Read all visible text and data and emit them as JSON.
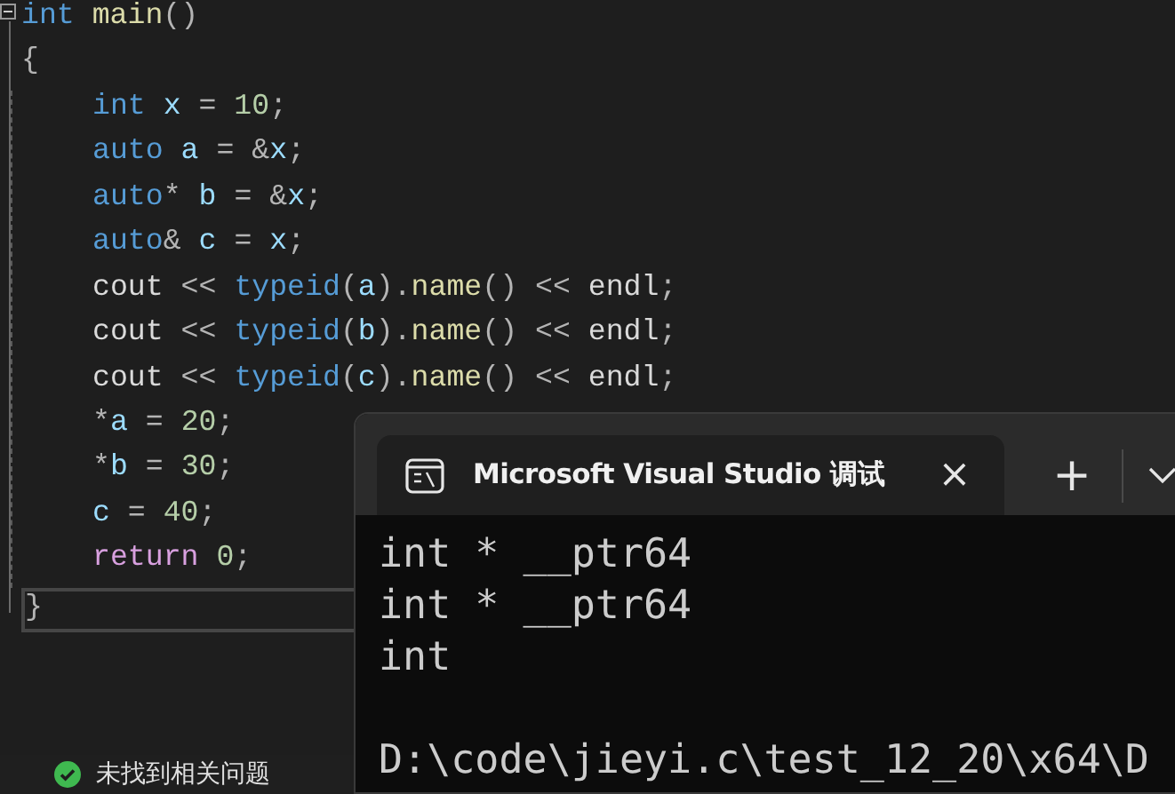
{
  "editor": {
    "function": {
      "expanded": true,
      "header": [
        {
          "text": "int",
          "kind": "keyword"
        },
        {
          "text": " main",
          "kind": "function"
        },
        {
          "text": "()",
          "kind": "punct"
        }
      ],
      "open_brace": "{",
      "body": [
        [
          {
            "text": "int",
            "kind": "keyword"
          },
          {
            "text": " x",
            "kind": "variable"
          },
          {
            "text": " = ",
            "kind": "punct"
          },
          {
            "text": "10",
            "kind": "number"
          },
          {
            "text": ";",
            "kind": "punct"
          }
        ],
        [
          {
            "text": "auto",
            "kind": "keyword"
          },
          {
            "text": " a",
            "kind": "variable"
          },
          {
            "text": " = &",
            "kind": "punct"
          },
          {
            "text": "x",
            "kind": "variable"
          },
          {
            "text": ";",
            "kind": "punct"
          }
        ],
        [
          {
            "text": "auto",
            "kind": "keyword"
          },
          {
            "text": "* ",
            "kind": "punct"
          },
          {
            "text": "b",
            "kind": "variable"
          },
          {
            "text": " = &",
            "kind": "punct"
          },
          {
            "text": "x",
            "kind": "variable"
          },
          {
            "text": ";",
            "kind": "punct"
          }
        ],
        [
          {
            "text": "auto",
            "kind": "keyword"
          },
          {
            "text": "& ",
            "kind": "punct"
          },
          {
            "text": "c",
            "kind": "variable"
          },
          {
            "text": " = ",
            "kind": "punct"
          },
          {
            "text": "x",
            "kind": "variable"
          },
          {
            "text": ";",
            "kind": "punct"
          }
        ],
        [
          {
            "text": "cout",
            "kind": "stream"
          },
          {
            "text": " << ",
            "kind": "punct"
          },
          {
            "text": "typeid",
            "kind": "keyword"
          },
          {
            "text": "(",
            "kind": "punct"
          },
          {
            "text": "a",
            "kind": "variable"
          },
          {
            "text": ").",
            "kind": "punct"
          },
          {
            "text": "name",
            "kind": "function"
          },
          {
            "text": "() << ",
            "kind": "punct"
          },
          {
            "text": "endl",
            "kind": "stream"
          },
          {
            "text": ";",
            "kind": "punct"
          }
        ],
        [
          {
            "text": "cout",
            "kind": "stream"
          },
          {
            "text": " << ",
            "kind": "punct"
          },
          {
            "text": "typeid",
            "kind": "keyword"
          },
          {
            "text": "(",
            "kind": "punct"
          },
          {
            "text": "b",
            "kind": "variable"
          },
          {
            "text": ").",
            "kind": "punct"
          },
          {
            "text": "name",
            "kind": "function"
          },
          {
            "text": "() << ",
            "kind": "punct"
          },
          {
            "text": "endl",
            "kind": "stream"
          },
          {
            "text": ";",
            "kind": "punct"
          }
        ],
        [
          {
            "text": "cout",
            "kind": "stream"
          },
          {
            "text": " << ",
            "kind": "punct"
          },
          {
            "text": "typeid",
            "kind": "keyword"
          },
          {
            "text": "(",
            "kind": "punct"
          },
          {
            "text": "c",
            "kind": "variable"
          },
          {
            "text": ").",
            "kind": "punct"
          },
          {
            "text": "name",
            "kind": "function"
          },
          {
            "text": "() << ",
            "kind": "punct"
          },
          {
            "text": "endl",
            "kind": "stream"
          },
          {
            "text": ";",
            "kind": "punct"
          }
        ],
        [
          {
            "text": "*",
            "kind": "punct"
          },
          {
            "text": "a",
            "kind": "variable"
          },
          {
            "text": " = ",
            "kind": "punct"
          },
          {
            "text": "20",
            "kind": "number"
          },
          {
            "text": ";",
            "kind": "punct"
          }
        ],
        [
          {
            "text": "*",
            "kind": "punct"
          },
          {
            "text": "b",
            "kind": "variable"
          },
          {
            "text": " = ",
            "kind": "punct"
          },
          {
            "text": "30",
            "kind": "number"
          },
          {
            "text": ";",
            "kind": "punct"
          }
        ],
        [
          {
            "text": "c",
            "kind": "variable"
          },
          {
            "text": " = ",
            "kind": "punct"
          },
          {
            "text": "40",
            "kind": "number"
          },
          {
            "text": ";",
            "kind": "punct"
          }
        ],
        [
          {
            "text": "return",
            "kind": "control"
          },
          {
            "text": " 0",
            "kind": "number"
          },
          {
            "text": ";",
            "kind": "punct"
          }
        ]
      ],
      "close_brace": "}",
      "close_line_current": true
    }
  },
  "terminal": {
    "tab": {
      "title": "Microsoft Visual Studio 调试",
      "close": "×"
    },
    "new_tab": "+",
    "output": [
      [
        "int * __ptr64",
        "int * __ptr64",
        "int"
      ],
      [
        "D:\\code\\jieyi.c\\test_12_20\\x64\\D"
      ]
    ]
  },
  "status_bar": {
    "message": "未找到相关问题",
    "ok": true
  }
}
